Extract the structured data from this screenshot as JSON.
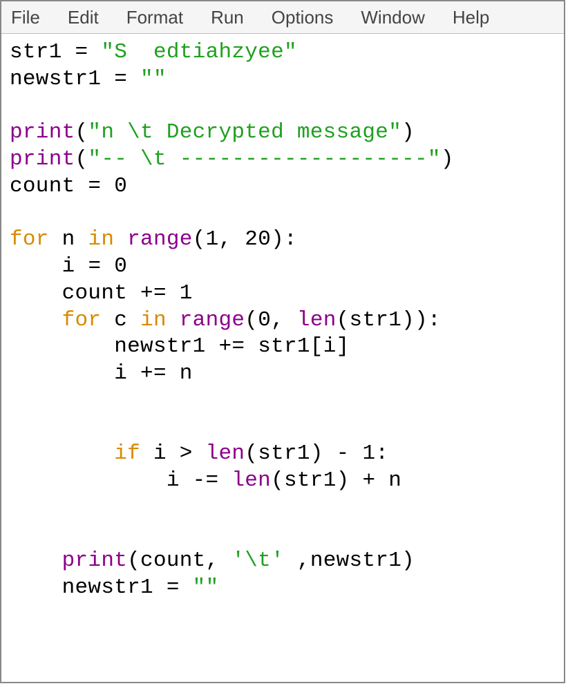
{
  "menu": {
    "file": "File",
    "edit": "Edit",
    "format": "Format",
    "run": "Run",
    "options": "Options",
    "window": "Window",
    "help": "Help"
  },
  "code": {
    "l01_var": "str1",
    "l01_eq": "=",
    "l01_str": "\"S  edtiahzyee\"",
    "l02_var": "newstr1",
    "l02_eq": "=",
    "l02_str": "\"\"",
    "l04_print": "print",
    "l04_open": "(",
    "l04_str": "\"n \\t Decrypted message\"",
    "l04_close": ")",
    "l05_print": "print",
    "l05_open": "(",
    "l05_str": "\"-- \\t -------------------\"",
    "l05_close": ")",
    "l06_var": "count",
    "l06_eq": "=",
    "l06_num": "0",
    "l08_for": "for",
    "l08_n": "n",
    "l08_in": "in",
    "l08_range": "range",
    "l08_open": "(",
    "l08_a": "1",
    "l08_comma": ",",
    "l08_b": "20",
    "l08_close": "):",
    "l09_i": "i",
    "l09_eq": "=",
    "l09_num": "0",
    "l10_var": "count",
    "l10_op": "+=",
    "l10_num": "1",
    "l11_for": "for",
    "l11_c": "c",
    "l11_in": "in",
    "l11_range": "range",
    "l11_open": "(",
    "l11_a": "0",
    "l11_comma": ",",
    "l11_len": "len",
    "l11_lenopen": "(",
    "l11_str1": "str1",
    "l11_close": ")):",
    "l12_new": "newstr1",
    "l12_op": "+=",
    "l12_str1": "str1[i]",
    "l13_i": "i",
    "l13_op": "+=",
    "l13_n": "n",
    "l16_if": "if",
    "l16_i": "i",
    "l16_gt": ">",
    "l16_len": "len",
    "l16_open": "(",
    "l16_str1": "str1",
    "l16_close": ")",
    "l16_minus": "-",
    "l16_one": "1",
    "l16_colon": ":",
    "l17_i": "i",
    "l17_op": "-=",
    "l17_len": "len",
    "l17_open": "(",
    "l17_str1": "str1",
    "l17_close": ")",
    "l17_plus": "+",
    "l17_n": "n",
    "l20_print": "print",
    "l20_open": "(",
    "l20_count": "count",
    "l20_comma1": ",",
    "l20_tab": "'\\t'",
    "l20_comma2": ",",
    "l20_new": "newstr1",
    "l20_close": ")",
    "l21_new": "newstr1",
    "l21_eq": "=",
    "l21_str": "\"\""
  }
}
